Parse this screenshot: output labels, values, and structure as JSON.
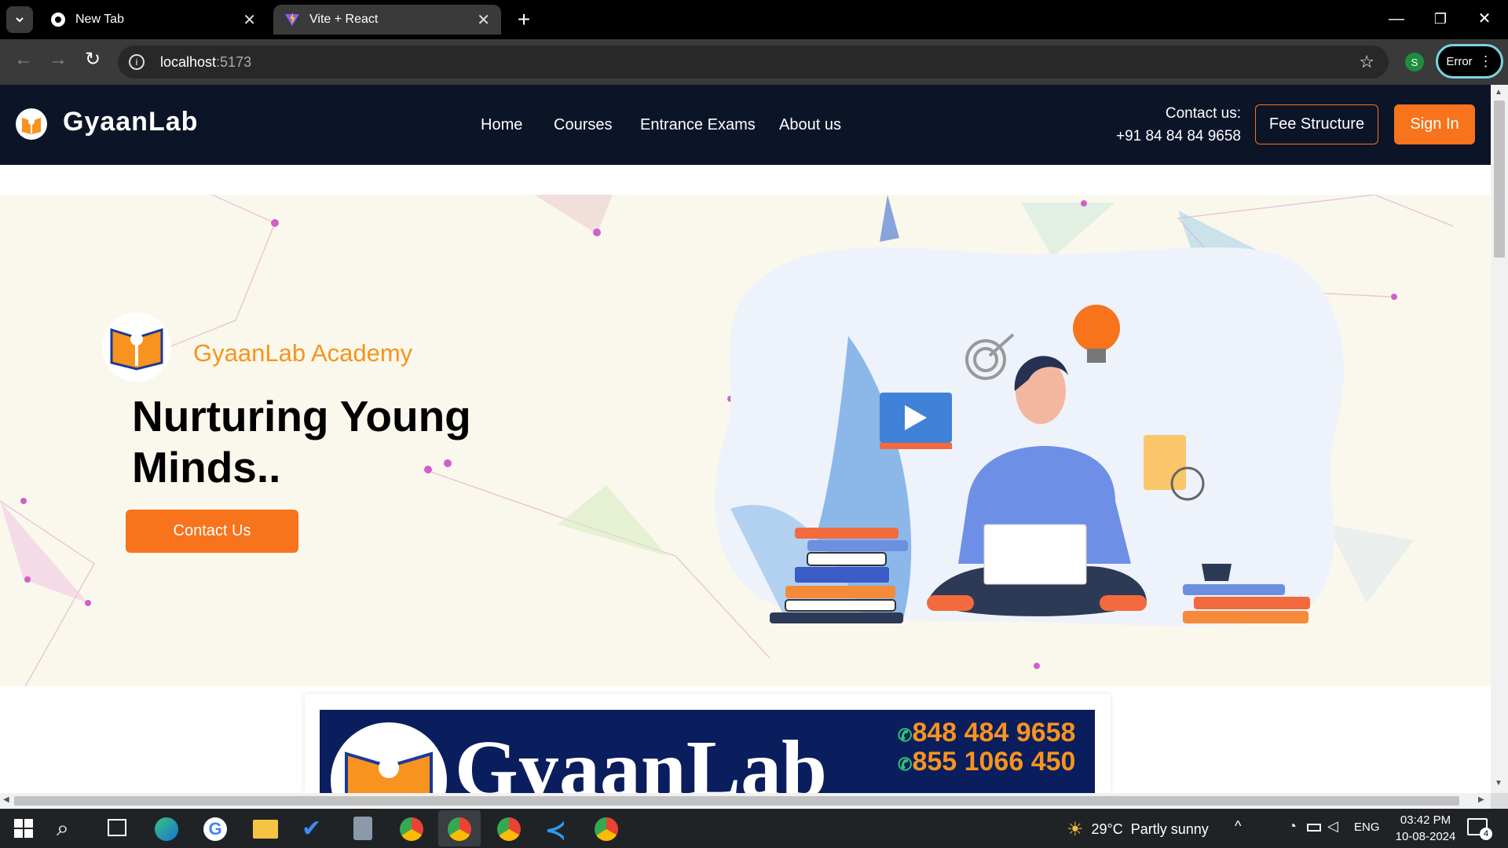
{
  "browser": {
    "tabs": [
      {
        "title": "New Tab",
        "active": false,
        "icon": "chrome-icon"
      },
      {
        "title": "Vite + React",
        "active": true,
        "icon": "vite-icon"
      }
    ],
    "address": {
      "host": "localhost",
      "port": ":5173"
    },
    "profile_initial": "S",
    "error_label": "Error"
  },
  "site": {
    "brand": "GyaanLab",
    "nav": [
      "Home",
      "Courses",
      "Entrance Exams",
      "About us"
    ],
    "contact_label": "Contact us:",
    "contact_phone": "+91 84 84 84 9658",
    "fee_button": "Fee Structure",
    "signin_button": "Sign In"
  },
  "hero": {
    "academy": "GyaanLab Academy",
    "headline_line1": "Nurturing Young",
    "headline_line2": "Minds..",
    "cta": "Contact Us"
  },
  "banner": {
    "brand": "GyaanLab",
    "phone1": "848 484 9658",
    "phone2": "855 1066 450"
  },
  "taskbar": {
    "weather_temp": "29°C",
    "weather_desc": "Partly sunny",
    "lang": "ENG",
    "time": "03:42 PM",
    "date": "10-08-2024",
    "notif_count": "4"
  },
  "colors": {
    "accent": "#f7731c",
    "navbar": "#0c1428",
    "hero_bg": "#faf8ec",
    "banner_bg": "#0a1e5e"
  }
}
